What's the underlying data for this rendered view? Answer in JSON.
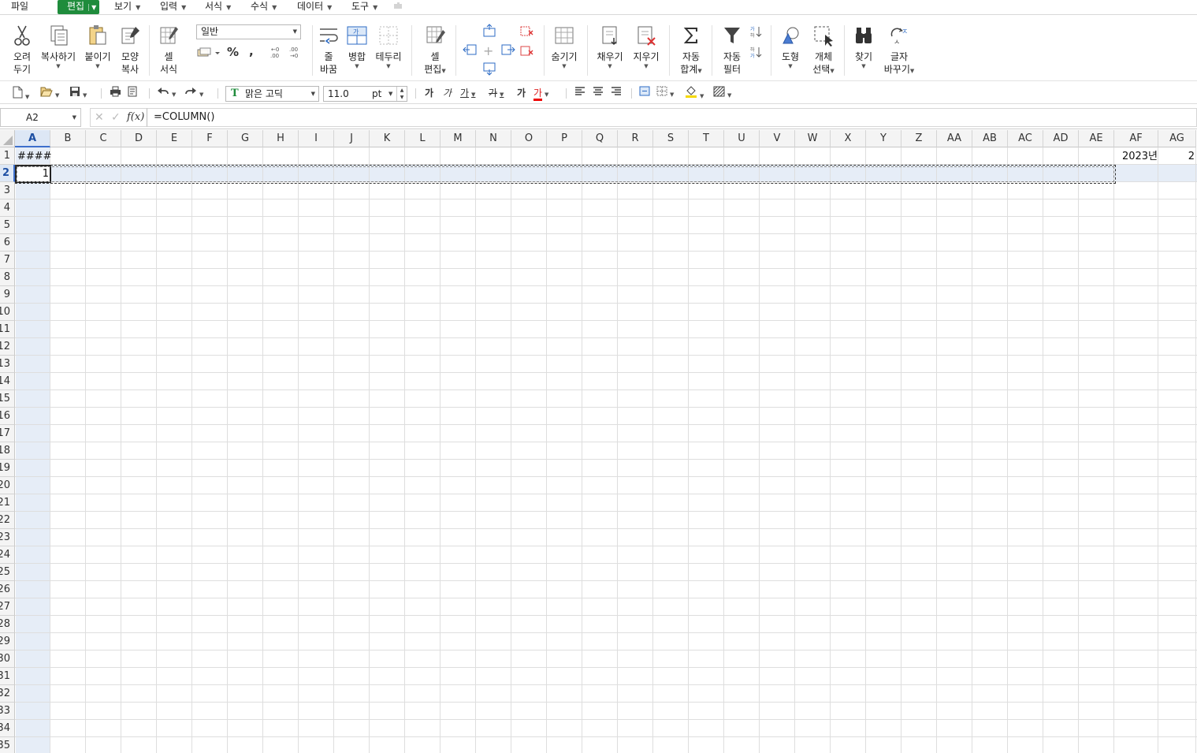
{
  "menu": {
    "file": "파일",
    "edit": "편집",
    "view": "보기",
    "input": "입력",
    "format": "서식",
    "formula": "수식",
    "data": "데이터",
    "tools": "도구"
  },
  "ribbon": {
    "cut_1": "오려",
    "cut_2": "두기",
    "copy": "복사하기",
    "paste": "붙이기",
    "format_painter_1": "모양",
    "format_painter_2": "복사",
    "cell_format_1": "셀",
    "cell_format_2": "서식",
    "number_format_value": "일반",
    "wrap_1": "줄",
    "wrap_2": "바꿈",
    "merge": "병합",
    "borders": "테두리",
    "cell_edit_1": "셀",
    "cell_edit_2": "편집",
    "hide": "숨기기",
    "fill": "채우기",
    "clear": "지우기",
    "autosum_1": "자동",
    "autosum_2": "합계",
    "autofilter_1": "자동",
    "autofilter_2": "필터",
    "shape": "도형",
    "select_object_1": "개체",
    "select_object_2": "선택",
    "find": "찾기",
    "replace_1": "글자",
    "replace_2": "바꾸기",
    "percent": "%",
    "comma": ","
  },
  "toolbar": {
    "font_name": "맑은 고딕",
    "font_size": "11.0",
    "font_unit": "pt",
    "bold": "가",
    "italic": "가",
    "underline": "가",
    "strike": "가",
    "bold2": "가",
    "font_color": "가"
  },
  "formula_bar": {
    "name_box": "A2",
    "fx_label": "f(x)",
    "formula": "=COLUMN()"
  },
  "columns": [
    "A",
    "B",
    "C",
    "D",
    "E",
    "F",
    "G",
    "H",
    "I",
    "J",
    "K",
    "L",
    "M",
    "N",
    "O",
    "P",
    "Q",
    "R",
    "S",
    "T",
    "U",
    "V",
    "W",
    "X",
    "Y",
    "Z",
    "AA",
    "AB",
    "AC",
    "AD",
    "AE",
    "AF",
    "AG"
  ],
  "rows": [
    "1",
    "2",
    "3",
    "4",
    "5",
    "6",
    "7",
    "8",
    "9",
    "10",
    "11",
    "12",
    "13",
    "14",
    "15",
    "16",
    "17",
    "18",
    "19",
    "20",
    "21",
    "22",
    "23",
    "24",
    "25",
    "26",
    "27",
    "28",
    "29",
    "30",
    "31",
    "32",
    "33",
    "34",
    "35"
  ],
  "cells": {
    "A1": "####",
    "A2": "1",
    "AF1": "2023년",
    "AG1": "2"
  },
  "selection": {
    "active_cell": "A2",
    "active_column": "A",
    "active_row": "2"
  }
}
